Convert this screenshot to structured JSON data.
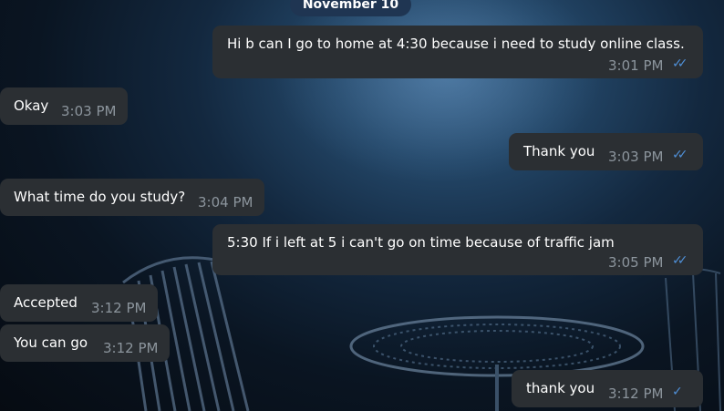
{
  "chat": {
    "date_separator": "November 10",
    "messages": [
      {
        "direction": "out",
        "text": "Hi b can I go to home at 4:30 because i need to study online class.",
        "time": "3:01 PM",
        "read": true
      },
      {
        "direction": "in",
        "text": "Okay",
        "time": "3:03 PM"
      },
      {
        "direction": "out",
        "text": "Thank you",
        "time": "3:03 PM",
        "read": true
      },
      {
        "direction": "in",
        "text": "What time do you study?",
        "time": "3:04 PM"
      },
      {
        "direction": "out",
        "text": "5:30 If i left at 5 i can't go on time because of traffic jam",
        "time": "3:05 PM",
        "read": true
      },
      {
        "direction": "in",
        "text": "Accepted",
        "time": "3:12 PM"
      },
      {
        "direction": "in",
        "text": "You can go",
        "time": "3:12 PM"
      },
      {
        "direction": "out",
        "text": "thank you",
        "time": "3:12 PM",
        "read": false
      }
    ]
  },
  "icons": {
    "read_receipt": "double-check-icon",
    "sent_receipt": "single-check-icon"
  },
  "colors": {
    "bubble": "#2b2f33",
    "timestamp": "#8c959d",
    "check": "#4f8fd6",
    "date_pill": "#1f3552"
  }
}
